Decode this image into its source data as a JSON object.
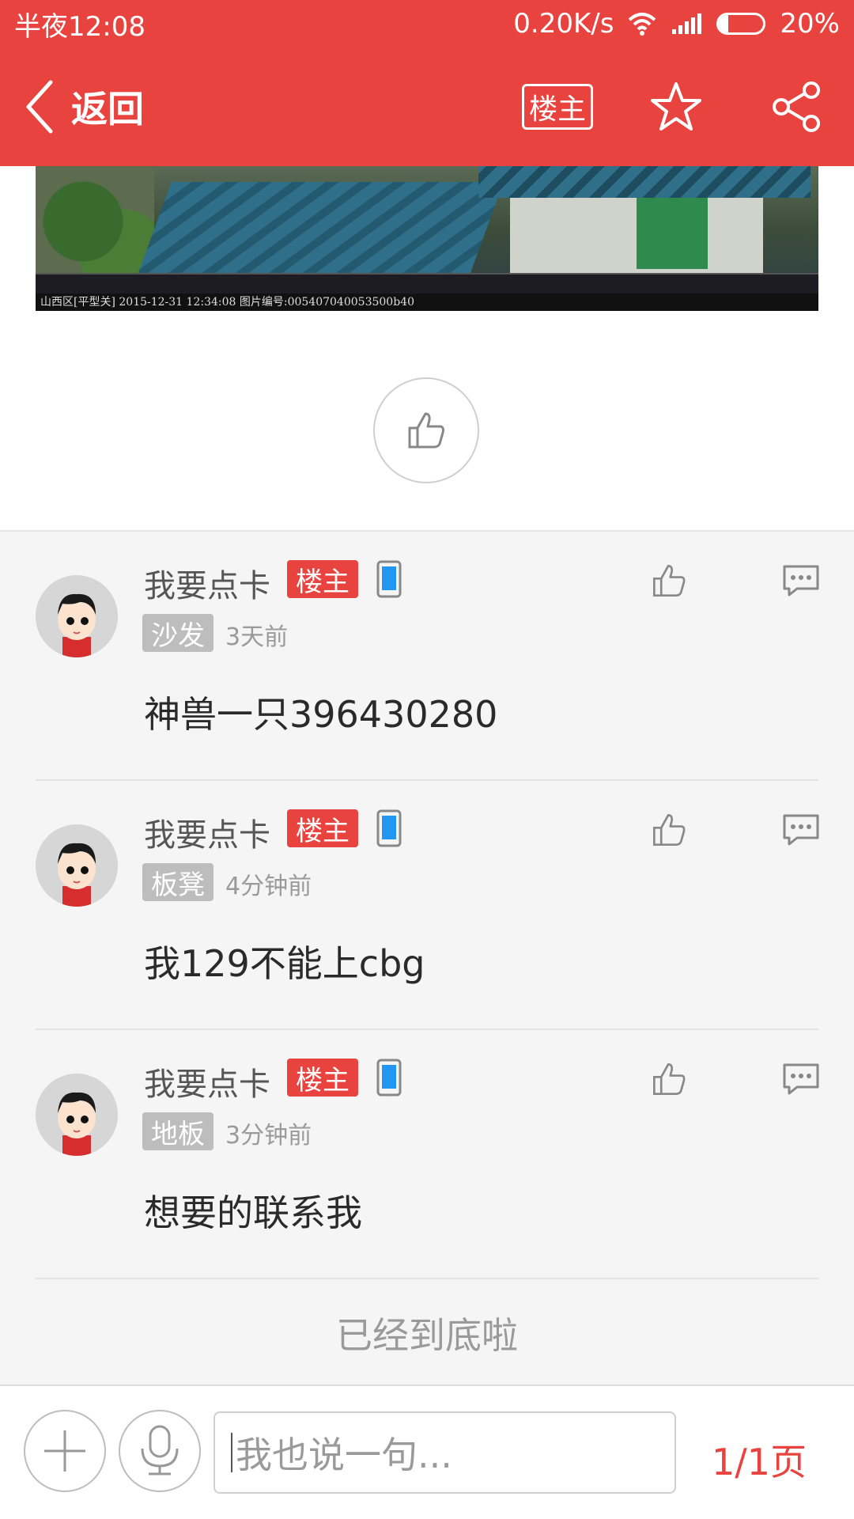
{
  "status_bar": {
    "time": "半夜12:08",
    "network_speed": "0.20K/s",
    "battery_percent": "20%",
    "battery_level": 0.2
  },
  "nav": {
    "back_label": "返回",
    "owner_filter_label": "楼主"
  },
  "image": {
    "caption": "山西区[平型关] 2015-12-31 12:34:08 图片编号:005407040053500b40"
  },
  "comments": [
    {
      "username": "我要点卡",
      "owner_badge": "楼主",
      "floor": "沙发",
      "time": "3天前",
      "content": "神兽一只396430280"
    },
    {
      "username": "我要点卡",
      "owner_badge": "楼主",
      "floor": "板凳",
      "time": "4分钟前",
      "content": "我129不能上cbg"
    },
    {
      "username": "我要点卡",
      "owner_badge": "楼主",
      "floor": "地板",
      "time": "3分钟前",
      "content": "想要的联系我"
    }
  ],
  "end_text": "已经到底啦",
  "bottom_bar": {
    "input_placeholder": "我也说一句...",
    "page_indicator": "1/1页"
  },
  "colors": {
    "accent": "#e8433f",
    "floor_badge": "#bdbdbd",
    "background": "#f5f5f5"
  },
  "icons": [
    "back-icon",
    "star-icon",
    "share-icon",
    "thumbs-up-icon",
    "comment-icon",
    "phone-icon",
    "plus-icon",
    "microphone-icon",
    "wifi-icon",
    "signal-icon",
    "battery-icon"
  ]
}
